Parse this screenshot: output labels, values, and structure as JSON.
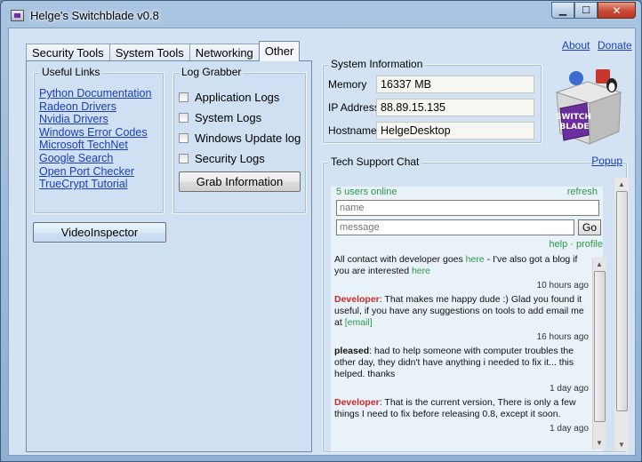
{
  "window": {
    "title": "Helge's Switchblade v0.8",
    "minimize_glyph": "▁",
    "maximize_glyph": "☐",
    "close_glyph": "✕"
  },
  "tabs": [
    {
      "label": "Security Tools"
    },
    {
      "label": "System Tools"
    },
    {
      "label": "Networking"
    },
    {
      "label": "Other"
    }
  ],
  "useful_links": {
    "legend": "Useful Links",
    "items": [
      "Python Documentation",
      "Radeon Drivers",
      "Nvidia Drivers",
      "Windows Error Codes",
      "Microsoft TechNet",
      "Google Search",
      "Open Port Checker",
      "TrueCrypt Tutorial"
    ]
  },
  "log_grabber": {
    "legend": "Log Grabber",
    "options": [
      "Application Logs",
      "System Logs",
      "Windows Update log",
      "Security Logs"
    ],
    "button": "Grab Information"
  },
  "video_inspector_button": "VideoInspector",
  "top_links": {
    "about": "About",
    "donate": "Donate"
  },
  "system_information": {
    "legend": "System Information",
    "memory_label": "Memory",
    "memory_value": "16337 MB",
    "ip_label": "IP Address",
    "ip_value": "88.89.15.135",
    "hostname_label": "Hostname",
    "hostname_value": "HelgeDesktop"
  },
  "logo": {
    "text_line1": "SWITCH",
    "text_line2": "BLADE"
  },
  "chat": {
    "legend": "Tech Support Chat",
    "popup": "Popup",
    "users_online": "5 users online",
    "refresh": "refresh",
    "name_placeholder": "name",
    "message_placeholder": "message",
    "go": "Go",
    "help": "help",
    "separator": "·",
    "profile": "profile",
    "intro_1": "All contact with developer goes ",
    "intro_here_1": "here",
    "intro_2": " - I've also got a blog if you are interested ",
    "intro_here_2": "here",
    "messages": [
      {
        "time": "10 hours ago",
        "author": "Developer",
        "text": ": That makes me happy dude :) Glad you found it useful, if you have any suggestions on tools to add email me at ",
        "link": "[email]"
      },
      {
        "time": "16 hours ago",
        "author": "pleased",
        "text": ": had to help someone with computer troubles the other day, they didn't have anything i needed to fix it... this helped. thanks",
        "link": ""
      },
      {
        "time": "1 day ago",
        "author": "Developer",
        "text": ": That is the current version, There is only a few things I need to fix before releasing 0.8, except it soon.",
        "link": ""
      },
      {
        "time": "1 day ago",
        "author": "",
        "text": "",
        "link": ""
      }
    ]
  },
  "colors": {
    "link_blue": "#1a3fb8",
    "chat_green": "#2a9a48",
    "developer_red": "#cc2a2a",
    "panel_blue": "#d4e3f3"
  }
}
